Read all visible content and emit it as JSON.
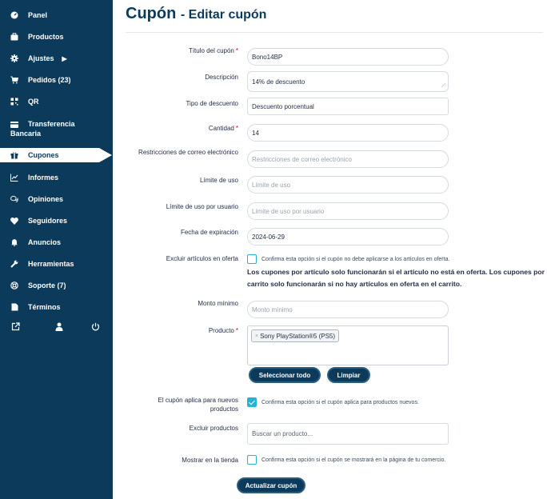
{
  "sidebar": {
    "items": [
      {
        "label": "Panel",
        "icon": "dashboard-icon"
      },
      {
        "label": "Productos",
        "icon": "briefcase-icon"
      },
      {
        "label": "Ajustes",
        "icon": "gear-icon"
      },
      {
        "label": "Pedidos (23)",
        "icon": "cart-icon"
      },
      {
        "label": "QR",
        "icon": "qr-icon"
      },
      {
        "label": "Transferencia",
        "label2": "Bancaria",
        "icon": "bank-card-icon"
      },
      {
        "label": "Cupones",
        "icon": "gift-icon"
      },
      {
        "label": "Informes",
        "icon": "chart-icon"
      },
      {
        "label": "Opiniones",
        "icon": "chat-icon"
      },
      {
        "label": "Seguidores",
        "icon": "heart-icon"
      },
      {
        "label": "Anuncios",
        "icon": "bell-icon"
      },
      {
        "label": "Herramientas",
        "icon": "wrench-icon"
      },
      {
        "label": "Soporte (7)",
        "icon": "lifebuoy-icon"
      },
      {
        "label": "Términos",
        "icon": "document-icon"
      }
    ],
    "bottom_icons": [
      "external-link-icon",
      "user-icon",
      "power-icon"
    ]
  },
  "header": {
    "title": "Cupón",
    "subtitle": "- Editar cupón"
  },
  "form": {
    "titulo": {
      "label": "Título del cupón",
      "value": "Bono14BP"
    },
    "descripcion": {
      "label": "Descripción",
      "value": "14% de descuento"
    },
    "tipo": {
      "label": "Tipo de descuento",
      "value": "Descuento porcentual"
    },
    "cantidad": {
      "label": "Cantidad",
      "value": "14"
    },
    "restricciones": {
      "label": "Restricciones de correo electrónico",
      "placeholder": "Restricciones de correo electrónico"
    },
    "limite_uso": {
      "label": "Límite de uso",
      "placeholder": "Límite de uso"
    },
    "limite_usuario": {
      "label": "Límite de uso por usuario",
      "placeholder": "Límite de uso por usuario"
    },
    "fecha": {
      "label": "Fecha de expiración",
      "value": "2024-06-29"
    },
    "excluir_oferta": {
      "label": "Excluir artículos en oferta",
      "checkbox_text": "Confirma esta opción si el cupón no debe aplicarse a los artículos en oferta.",
      "checked": false,
      "note": "Los cupones por artículo solo funcionarán si el artículo no está en oferta. Los cupones por carrito solo funcionarán si no hay artículos en oferta en el carrito."
    },
    "monto_minimo": {
      "label": "Monto mínimo",
      "placeholder": "Monto mínimo"
    },
    "producto": {
      "label": "Producto",
      "tag": "Sony PlayStation®5 (PS5)",
      "remove": "×"
    },
    "buttons": {
      "seleccionar": "Seleccionar todo",
      "limpiar": "Limpiar"
    },
    "nuevos": {
      "label_line1": "El cupón aplica para nuevos",
      "label_line2": "productos",
      "checkbox_text": "Confirma esta opción si el cupón aplica para productos nuevos.",
      "checked": true
    },
    "excluir_productos": {
      "label": "Excluir productos",
      "placeholder": "Buscar un producto..."
    },
    "mostrar": {
      "label": "Mostrar en la tienda",
      "checkbox_text": "Confirma esta opción si el cupón se mostrará en la página de tu comercio.",
      "checked": false
    },
    "submit": "Actualizar cupón"
  },
  "colors": {
    "sidebar": "#0c3a5b",
    "accent": "#27b3d6",
    "required": "#d0021b"
  }
}
